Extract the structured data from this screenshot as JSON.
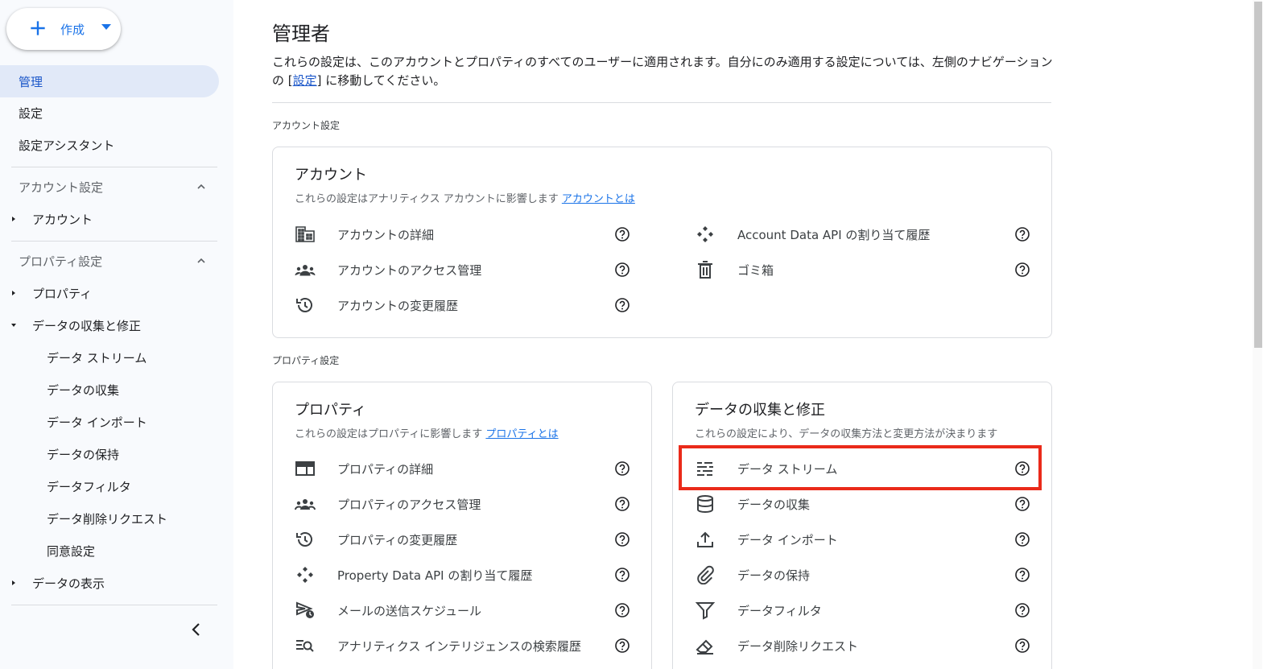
{
  "create_button": {
    "label": "作成"
  },
  "sidebar": {
    "top_items": [
      {
        "label": "管理",
        "active": true
      },
      {
        "label": "設定"
      },
      {
        "label": "設定アシスタント"
      }
    ],
    "account_section": {
      "label": "アカウント設定",
      "items": [
        {
          "label": "アカウント"
        }
      ]
    },
    "property_section": {
      "label": "プロパティ設定",
      "items": [
        {
          "label": "プロパティ"
        },
        {
          "label": "データの収集と修正",
          "children": [
            {
              "label": "データ ストリーム"
            },
            {
              "label": "データの収集"
            },
            {
              "label": "データ インポート"
            },
            {
              "label": "データの保持"
            },
            {
              "label": "データフィルタ"
            },
            {
              "label": "データ削除リクエスト"
            },
            {
              "label": "同意設定"
            }
          ]
        },
        {
          "label": "データの表示"
        }
      ]
    }
  },
  "main": {
    "title": "管理者",
    "desc_before": "これらの設定は、このアカウントとプロパティのすべてのユーザーに適用されます。自分にのみ適用する設定については、左側のナビゲーションの [",
    "desc_link": "設定",
    "desc_after": "] に移動してください。",
    "account_label": "アカウント設定",
    "property_label": "プロパティ設定",
    "account_card": {
      "title": "アカウント",
      "subtitle": "これらの設定はアナリティクス アカウントに影響します",
      "link": "アカウントとは",
      "left_rows": [
        {
          "label": "アカウントの詳細",
          "icon": "building-icon"
        },
        {
          "label": "アカウントのアクセス管理",
          "icon": "people-icon"
        },
        {
          "label": "アカウントの変更履歴",
          "icon": "history-icon"
        }
      ],
      "right_rows": [
        {
          "label": "Account Data API の割り当て履歴",
          "icon": "api-icon"
        },
        {
          "label": "ゴミ箱",
          "icon": "trash-icon"
        }
      ]
    },
    "property_card": {
      "title": "プロパティ",
      "subtitle": "これらの設定はプロパティに影響します",
      "link": "プロパティとは",
      "rows": [
        {
          "label": "プロパティの詳細",
          "icon": "property-details-icon"
        },
        {
          "label": "プロパティのアクセス管理",
          "icon": "people-icon"
        },
        {
          "label": "プロパティの変更履歴",
          "icon": "history-icon"
        },
        {
          "label": "Property Data API の割り当て履歴",
          "icon": "api-icon"
        },
        {
          "label": "メールの送信スケジュール",
          "icon": "schedule-send-icon"
        },
        {
          "label": "アナリティクス インテリジェンスの検索履歴",
          "icon": "search-history-icon"
        }
      ]
    },
    "data_card": {
      "title": "データの収集と修正",
      "subtitle": "これらの設定により、データの収集方法と変更方法が決まります",
      "rows": [
        {
          "label": "データ ストリーム",
          "icon": "data-stream-icon"
        },
        {
          "label": "データの収集",
          "icon": "database-icon"
        },
        {
          "label": "データ インポート",
          "icon": "upload-icon"
        },
        {
          "label": "データの保持",
          "icon": "attachment-icon"
        },
        {
          "label": "データフィルタ",
          "icon": "filter-icon"
        },
        {
          "label": "データ削除リクエスト",
          "icon": "eraser-icon"
        }
      ]
    }
  },
  "colors": {
    "accent": "#1a73e8",
    "highlight": "#ea2a1a",
    "active_bg": "#e1e9f8"
  }
}
